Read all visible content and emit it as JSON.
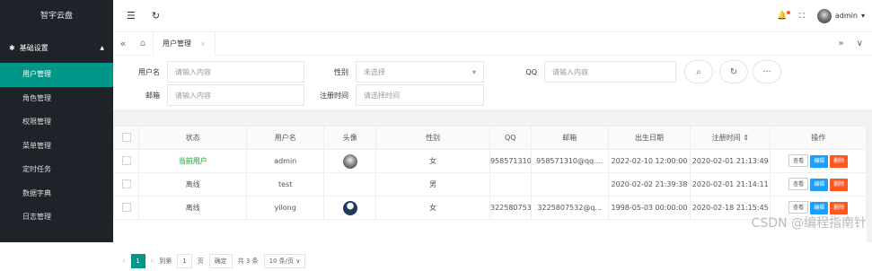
{
  "sidebar": {
    "brand": "智宇云盘",
    "group": {
      "label": "基础设置"
    },
    "items": [
      {
        "label": "用户管理"
      },
      {
        "label": "角色管理"
      },
      {
        "label": "权限管理"
      },
      {
        "label": "菜单管理"
      },
      {
        "label": "定时任务"
      },
      {
        "label": "数据字典"
      },
      {
        "label": "日志管理"
      }
    ]
  },
  "topbar": {
    "menu_icon": "☰",
    "refresh_icon": "↻",
    "user": "admin",
    "bell": "🔔",
    "fullscreen": "⛶",
    "caret": "▾"
  },
  "tabbar": {
    "prev": "«",
    "home": "⌂",
    "tab": {
      "label": "用户管理",
      "close": "×"
    },
    "next": "»",
    "more": "∨"
  },
  "search": {
    "username": {
      "label": "用户名",
      "placeholder": "请输入内容"
    },
    "gender": {
      "label": "性别",
      "value": "未选择"
    },
    "qq": {
      "label": "QQ",
      "placeholder": "请输入内容"
    },
    "email": {
      "label": "邮箱",
      "placeholder": "请输入内容"
    },
    "regtime": {
      "label": "注册时间",
      "placeholder": "请选择时间"
    },
    "search_icon": "⌕",
    "reset_icon": "↻",
    "more_icon": "···"
  },
  "table": {
    "headers": {
      "status": "状态",
      "username": "用户名",
      "avatar": "头像",
      "gender": "性别",
      "qq": "QQ",
      "email": "邮箱",
      "birth": "出生日期",
      "regtime": "注册时间",
      "sort": "⇕",
      "ops": "操作"
    },
    "rows": [
      {
        "status": "当前用户",
        "username": "admin",
        "gender": "女",
        "qq": "958571310",
        "email": "958571310@qq....",
        "birth": "2022-02-10 12:00:00",
        "regtime": "2020-02-01 21:13:49"
      },
      {
        "status": "离线",
        "username": "test",
        "gender": "男",
        "qq": "",
        "email": "",
        "birth": "2020-02-02 21:39:38",
        "regtime": "2020-02-01 21:14:11"
      },
      {
        "status": "离线",
        "username": "yilong",
        "gender": "女",
        "qq": "3225807532",
        "email": "3225807532@q...",
        "birth": "1998-05-03 00:00:00",
        "regtime": "2020-02-18 21:15:45"
      }
    ],
    "ops": {
      "view": "查看",
      "edit": "编辑",
      "delete": "删除"
    }
  },
  "pager": {
    "prev": "‹",
    "current": "1",
    "next": "›",
    "goto": "到第",
    "page_input": "1",
    "page_unit": "页",
    "confirm": "确定",
    "total": "共 3 条",
    "per_page": "10 条/页 ∨"
  },
  "watermark": "CSDN @编程指南针",
  "colors": {
    "sidebar_bg": "#20222a",
    "accent": "#009688",
    "edit": "#1e9fff",
    "delete": "#ff5722",
    "status_current": "#5fb878"
  }
}
